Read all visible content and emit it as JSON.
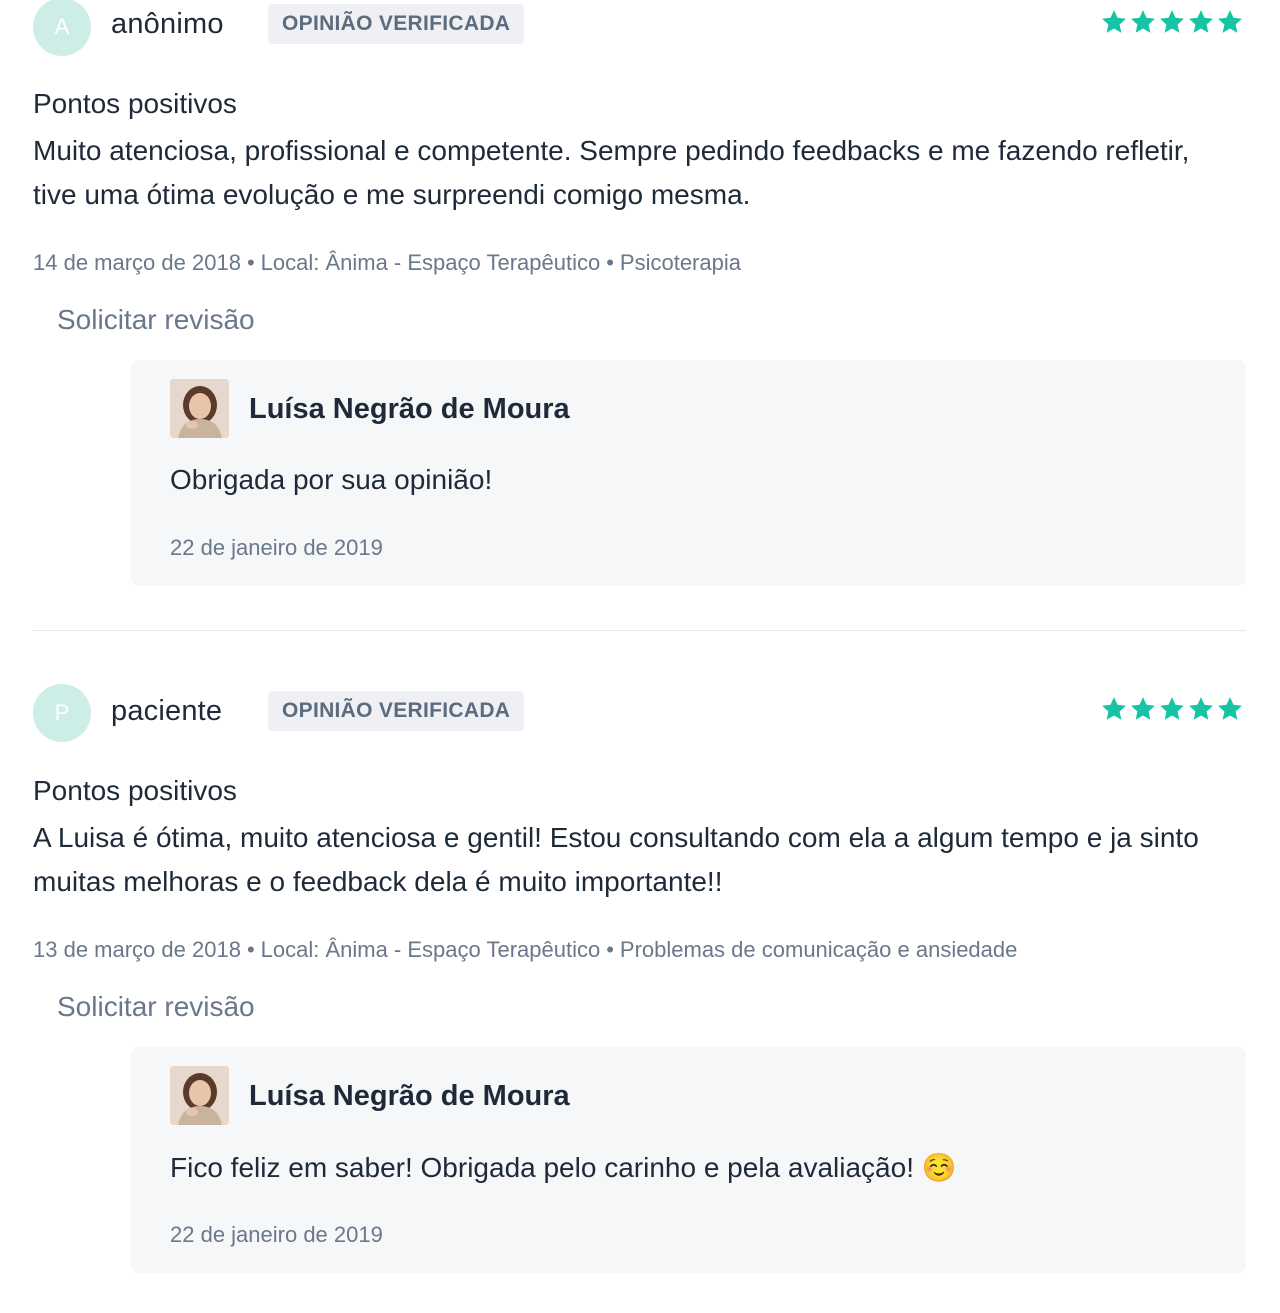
{
  "reviews": [
    {
      "avatar_initial": "A",
      "author": "anônimo",
      "badge": "OPINIÃO VERIFICADA",
      "rating": 5,
      "section_label": "Pontos positivos",
      "text": "Muito atenciosa, profissional e competente. Sempre pedindo feedbacks e me fazendo refletir, tive uma ótima evolução e me surpreendi comigo mesma.",
      "date": "14 de março de 2018",
      "location": "Local: Ânima - Espaço Terapêutico",
      "service": "Psicoterapia",
      "separator": "•",
      "request_review_label": "Solicitar revisão",
      "reply": {
        "name": "Luísa Negrão de Moura",
        "text": "Obrigada por sua opinião!",
        "date": "22 de janeiro de 2019"
      }
    },
    {
      "avatar_initial": "P",
      "author": "paciente",
      "badge": "OPINIÃO VERIFICADA",
      "rating": 5,
      "section_label": "Pontos positivos",
      "text": "A Luisa é ótima, muito atenciosa e gentil! Estou consultando com ela a algum tempo e ja sinto muitas melhoras e o feedback dela é muito importante!!",
      "date": "13 de março de 2018",
      "location": "Local: Ânima - Espaço Terapêutico",
      "service": "Problemas de comunicação e ansiedade",
      "separator": "•",
      "request_review_label": "Solicitar revisão",
      "reply": {
        "name": "Luísa Negrão de Moura",
        "text": "Fico feliz em saber! Obrigada pelo carinho e pela avaliação! ☺️",
        "date": "22 de janeiro de 2019"
      }
    }
  ],
  "colors": {
    "star": "#14c4a4",
    "avatar_bg": "#cdeee6",
    "badge_bg": "#eef0f3",
    "reply_bg": "#f5f7f9",
    "muted_text": "#6b778a"
  }
}
